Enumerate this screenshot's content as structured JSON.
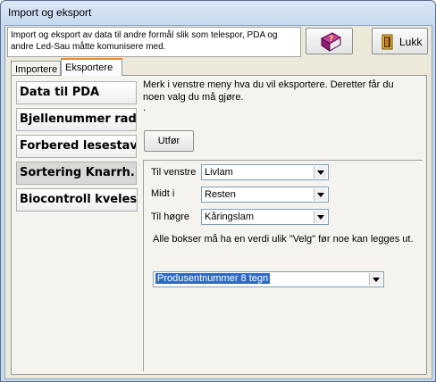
{
  "window": {
    "title": "Import og eksport"
  },
  "header": {
    "description": "Import og eksport av data til andre formål slik som telespor, PDA og andre Led-Sau måtte komunisere med."
  },
  "toolbar": {
    "close_label": "Lukk",
    "help_icon": "help-book-icon",
    "close_icon": "exit-door-icon"
  },
  "tabs": [
    {
      "label": "Importere",
      "active": false
    },
    {
      "label": "Eksportere",
      "active": true
    }
  ],
  "menu": {
    "items": [
      {
        "label": "Data til PDA",
        "selected": false
      },
      {
        "label": "Bjellenummer radio",
        "selected": false
      },
      {
        "label": "Forbered lesestav",
        "selected": false
      },
      {
        "label": "Sortering Knarrh...",
        "selected": true
      },
      {
        "label": "Biocontroll kveleser",
        "selected": false
      }
    ]
  },
  "content": {
    "instructions": "Merk i venstre meny hva du vil eksportere. Deretter får du noen valg du må gjøre.",
    "dot": ".",
    "run_label": "Utfør",
    "left_label": "Til venstre",
    "left_value": "Livlam",
    "middle_label": "Midt i",
    "middle_value": "Resten",
    "right_label": "Til høgre",
    "right_value": "Kåringslam",
    "note": "Alle bokser må ha en verdi ulik \"Velg\" før noe kan legges ut.",
    "product_value": "Produsentnummer 8 tegn"
  }
}
